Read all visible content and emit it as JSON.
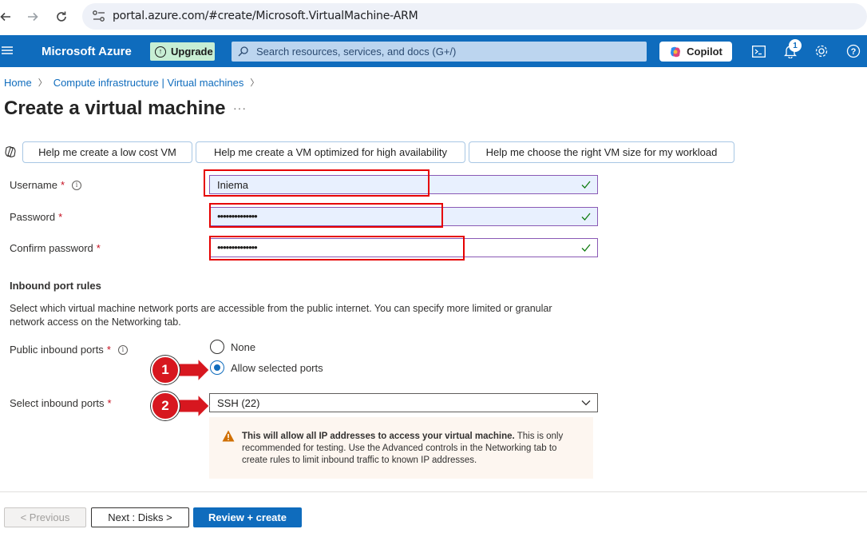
{
  "browser": {
    "url": "portal.azure.com/#create/Microsoft.VirtualMachine-ARM"
  },
  "header": {
    "brand": "Microsoft Azure",
    "upgrade_label": "Upgrade",
    "search_placeholder": "Search resources, services, and docs (G+/)",
    "copilot_label": "Copilot",
    "notification_count": "1"
  },
  "breadcrumb": {
    "items": [
      "Home",
      "Compute infrastructure | Virtual machines"
    ]
  },
  "page": {
    "title": "Create a virtual machine",
    "more": "···"
  },
  "help_buttons": [
    "Help me create a low cost VM",
    "Help me create a VM optimized for high availability",
    "Help me choose the right VM size for my workload"
  ],
  "form": {
    "username_label": "Username",
    "username_value": "Iniema",
    "password_label": "Password",
    "password_value": "••••••••••••••",
    "confirm_label": "Confirm password",
    "confirm_value": "••••••••••••••",
    "required_mark": "*"
  },
  "inbound": {
    "section_title": "Inbound port rules",
    "description": "Select which virtual machine network ports are accessible from the public internet. You can specify more limited or granular network access on the Networking tab.",
    "public_ports_label": "Public inbound ports",
    "options": [
      "None",
      "Allow selected ports"
    ],
    "selected_option": "Allow selected ports",
    "select_ports_label": "Select inbound ports",
    "select_ports_value": "SSH (22)",
    "warning_bold": "This will allow all IP addresses to access your virtual machine.",
    "warning_rest": " This is only recommended for testing.  Use the Advanced controls in the Networking tab to create rules to limit inbound traffic to known IP addresses."
  },
  "markers": [
    "1",
    "2"
  ],
  "footer": {
    "previous_label": "< Previous",
    "next_label": "Next : Disks >",
    "review_label": "Review + create"
  },
  "colors": {
    "azure_blue": "#0f6cbd",
    "highlight_red": "#e60000",
    "marker_red": "#d7171f",
    "valid_green": "#107c10",
    "warning_orange": "#d06f00"
  }
}
